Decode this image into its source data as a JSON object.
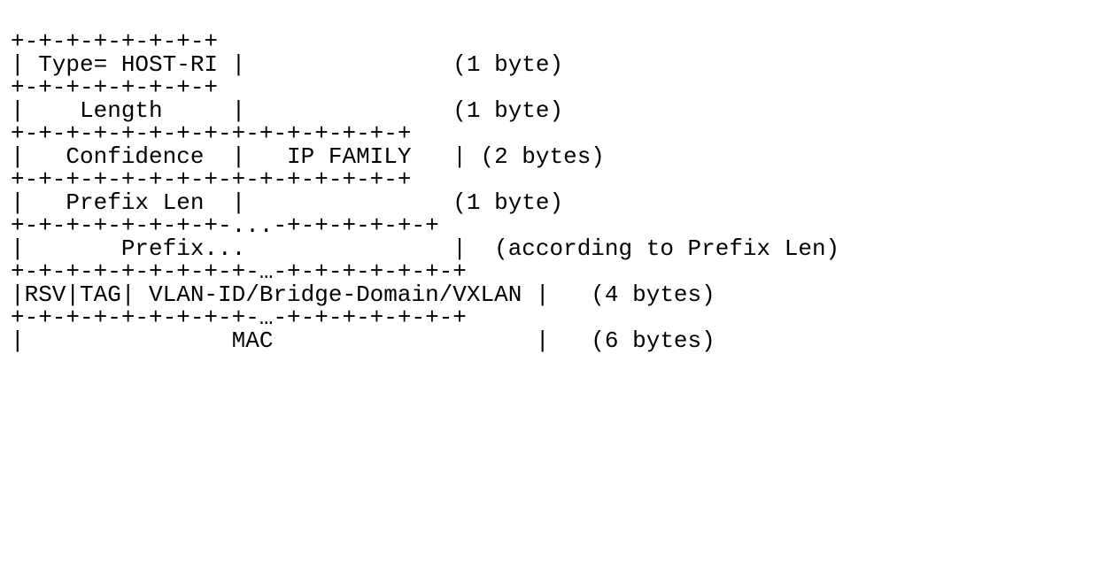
{
  "diagram": {
    "lines": [
      "+-+-+-+-+-+-+-+",
      "| Type= HOST-RI |               (1 byte)",
      "+-+-+-+-+-+-+-+",
      "|    Length     |               (1 byte)",
      "+-+-+-+-+-+-+-+-+-+-+-+-+-+-+",
      "|   Confidence  |   IP FAMILY   | (2 bytes)",
      "+-+-+-+-+-+-+-+-+-+-+-+-+-+-+",
      "|   Prefix Len  |               (1 byte)",
      "+-+-+-+-+-+-+-+-...-+-+-+-+-+-+",
      "|       Prefix...               |  (according to Prefix Len)",
      "+-+-+-+-+-+-+-+-+-…-+-+-+-+-+-+-+",
      "|RSV|TAG| VLAN-ID/Bridge-Domain/VXLAN |   (4 bytes)",
      "+-+-+-+-+-+-+-+-+-…-+-+-+-+-+-+-+",
      "|               MAC                   |   (6 bytes)"
    ]
  },
  "fields": [
    {
      "name": "Type",
      "value": "HOST-RI",
      "size_bytes": 1
    },
    {
      "name": "Length",
      "value": "",
      "size_bytes": 1
    },
    {
      "name": "Confidence",
      "value": "",
      "size_bytes": 1,
      "group_size_bytes": 2
    },
    {
      "name": "IP FAMILY",
      "value": "",
      "size_bytes": 1,
      "group_size_bytes": 2
    },
    {
      "name": "Prefix Len",
      "value": "",
      "size_bytes": 1
    },
    {
      "name": "Prefix",
      "value": "...",
      "size_note": "according to Prefix Len"
    },
    {
      "name": "RSV",
      "value": "",
      "group_size_bytes": 4
    },
    {
      "name": "TAG",
      "value": "",
      "group_size_bytes": 4
    },
    {
      "name": "VLAN-ID/Bridge-Domain/VXLAN",
      "value": "",
      "group_size_bytes": 4
    },
    {
      "name": "MAC",
      "value": "",
      "size_bytes": 6
    }
  ]
}
